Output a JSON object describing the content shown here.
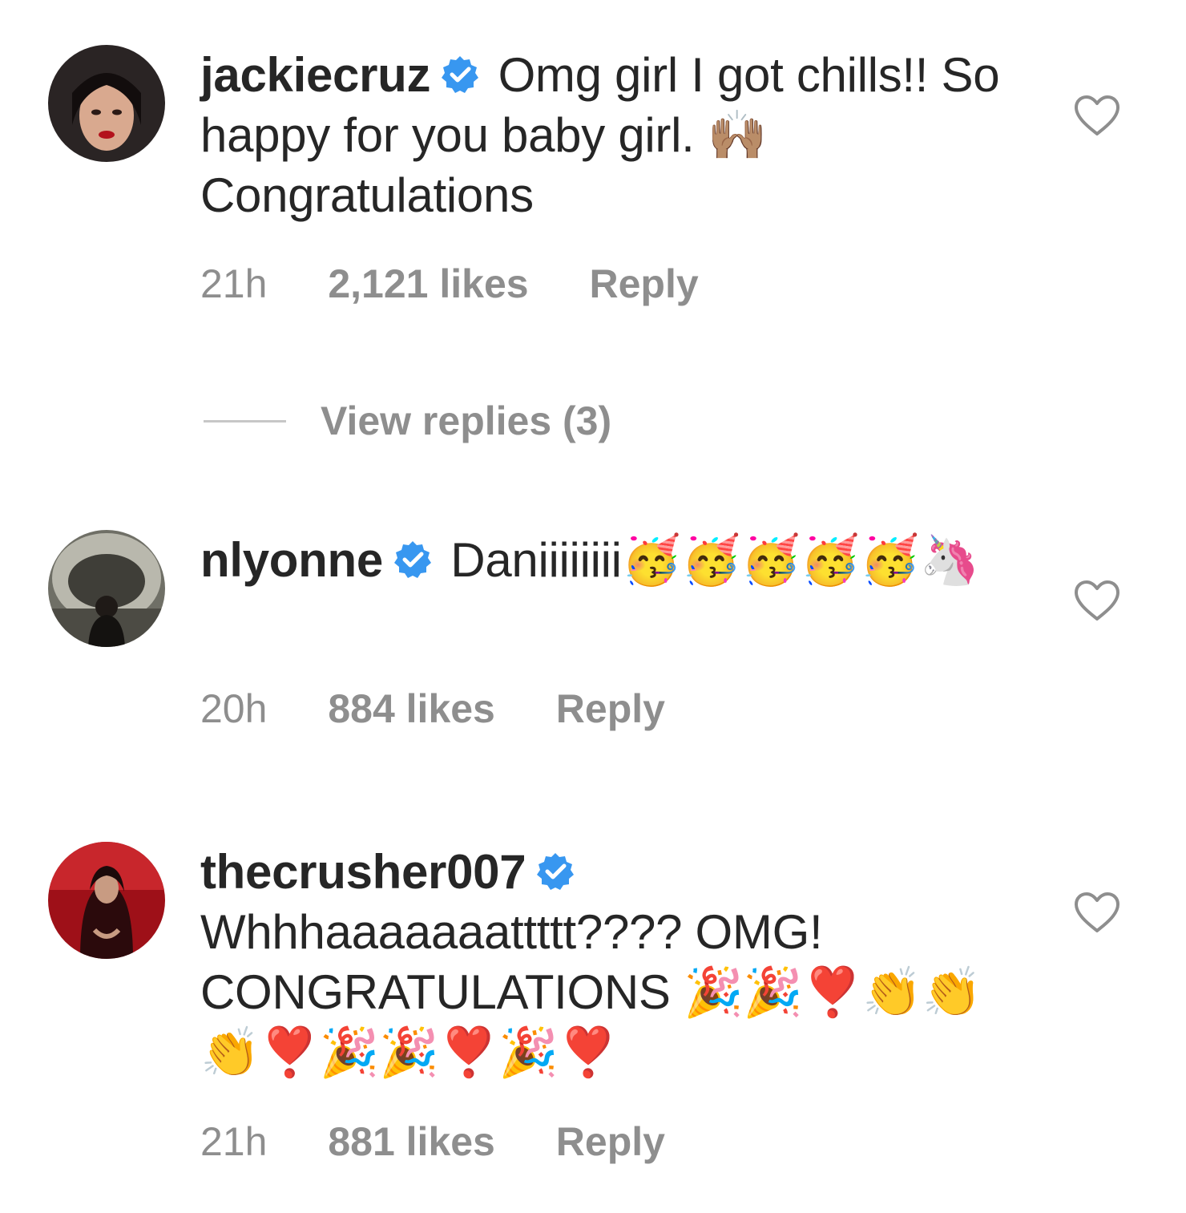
{
  "comments": [
    {
      "username": "jackiecruz",
      "text": "Omg girl I got chills!! So happy for you baby girl. 🙌🏽 Congratulations",
      "time": "21h",
      "likes": "2,121 likes",
      "reply_label": "Reply",
      "view_replies": "View replies (3)"
    },
    {
      "username": "nlyonne",
      "text": "Daniiiiiiii🥳🥳🥳🥳🥳🦄",
      "time": "20h",
      "likes": "884 likes",
      "reply_label": "Reply"
    },
    {
      "username": "thecrusher007",
      "text": "Whhhaaaaaaattttt???? OMG! CONGRATULATIONS 🎉🎉❣️👏👏👏❣️🎉🎉❣️🎉❣️",
      "time": "21h",
      "likes": "881 likes",
      "reply_label": "Reply"
    }
  ],
  "colors": {
    "text": "#262626",
    "meta": "#8e8e8e",
    "verified": "#3897f0",
    "divider": "#c7c7c7"
  },
  "icons": {
    "verified": "verified-badge-icon",
    "like": "heart-outline-icon"
  }
}
